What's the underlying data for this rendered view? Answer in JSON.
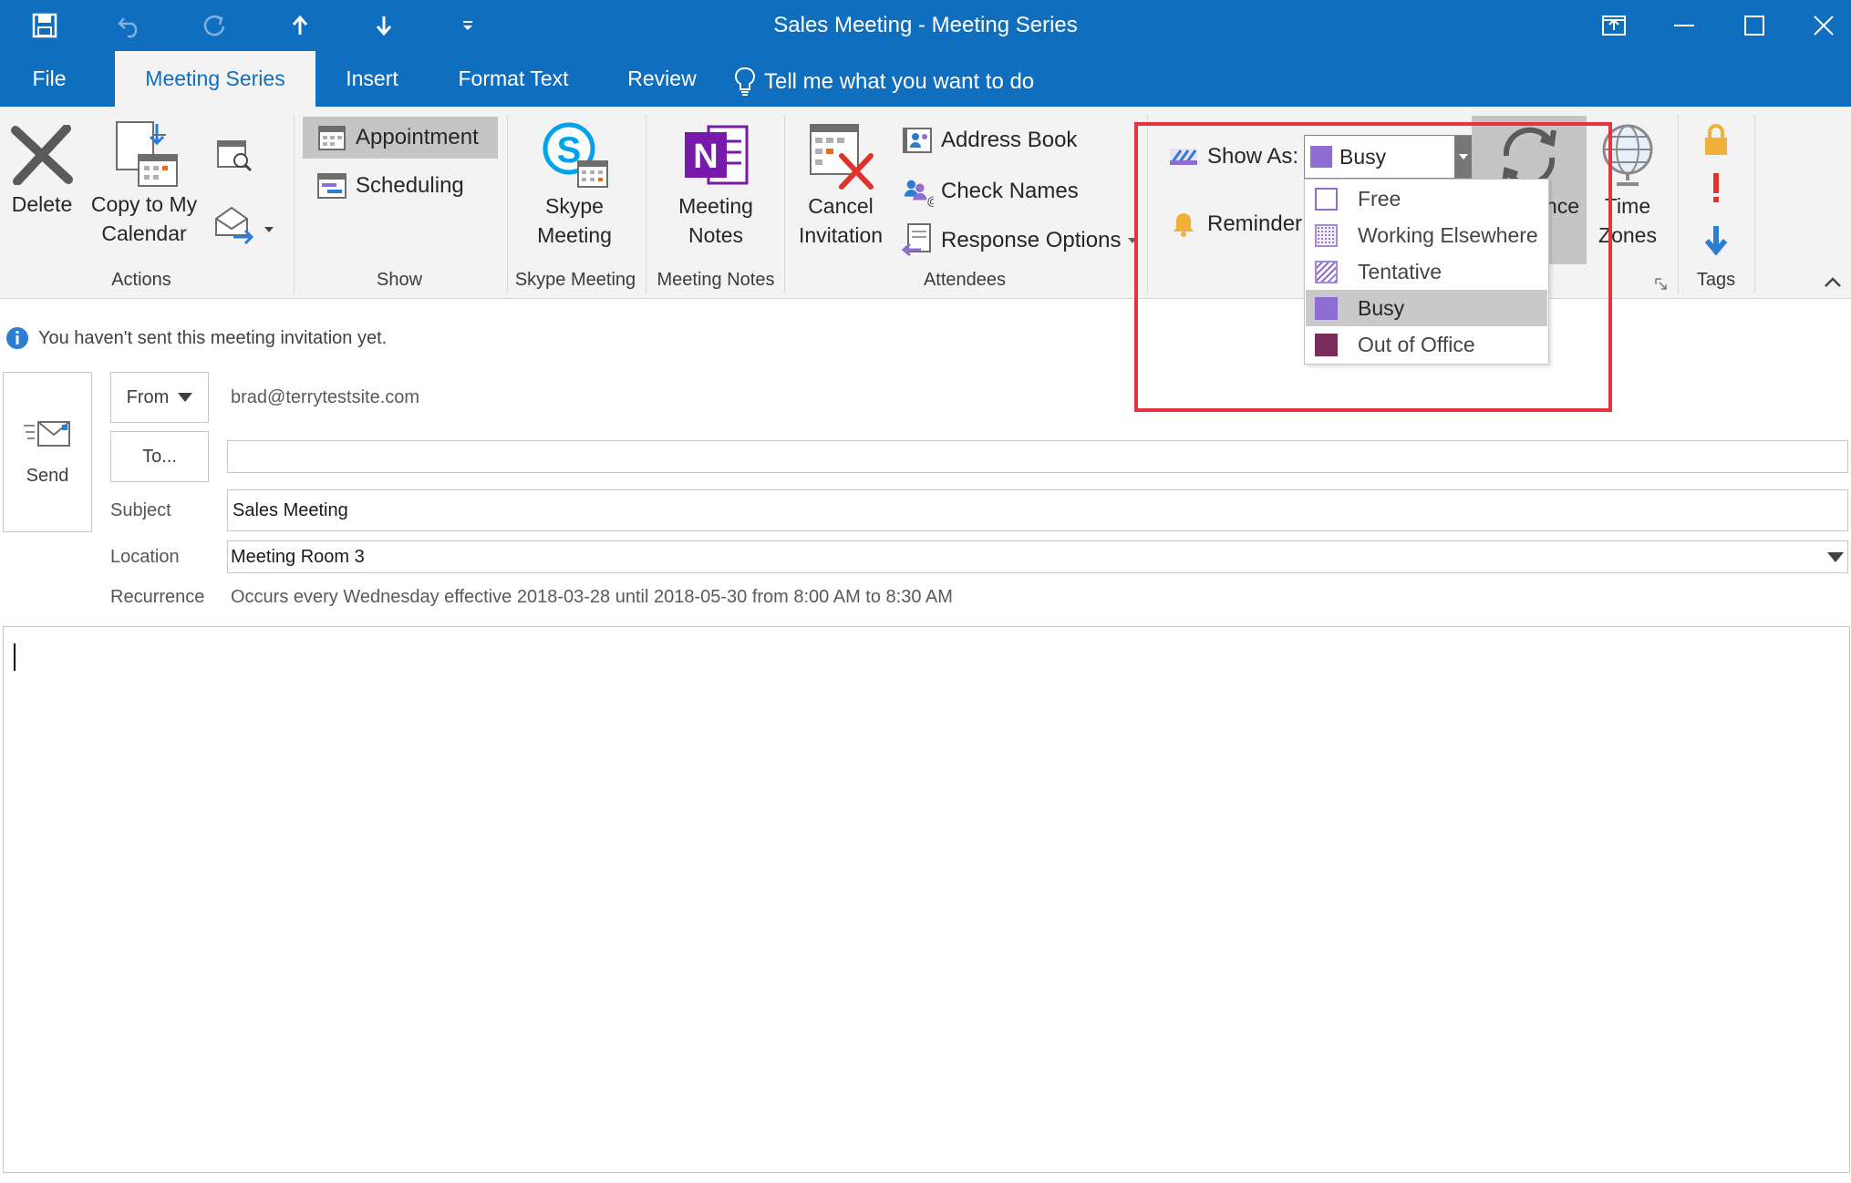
{
  "window": {
    "title": "Sales Meeting  -  Meeting Series"
  },
  "tabs": [
    {
      "label": "File"
    },
    {
      "label": "Meeting Series"
    },
    {
      "label": "Insert"
    },
    {
      "label": "Format Text"
    },
    {
      "label": "Review"
    }
  ],
  "tell_me": "Tell me what you want to do",
  "ribbon": {
    "actions": {
      "delete": "Delete",
      "copy_line1": "Copy to My",
      "copy_line2": "Calendar",
      "group": "Actions"
    },
    "show": {
      "appointment": "Appointment",
      "scheduling": "Scheduling",
      "group": "Show"
    },
    "skype": {
      "line1": "Skype",
      "line2": "Meeting",
      "group": "Skype Meeting"
    },
    "notes": {
      "line1": "Meeting",
      "line2": "Notes",
      "group": "Meeting Notes"
    },
    "attendees": {
      "cancel_line1": "Cancel",
      "cancel_line2": "Invitation",
      "address_book": "Address Book",
      "check_names": "Check Names",
      "response_options": "Response Options",
      "group": "Attendees"
    },
    "options": {
      "show_as_label": "Show As:",
      "show_as_value": "Busy",
      "reminder_label": "Reminder:",
      "recurrence_fragment": "nce",
      "time_zones_line1": "Time",
      "time_zones_line2": "Zones"
    },
    "tags": {
      "group": "Tags"
    }
  },
  "show_as_menu": {
    "items": [
      {
        "label": "Free",
        "color": "#ffffff"
      },
      {
        "label": "Working Elsewhere",
        "color": "#e8e0f5"
      },
      {
        "label": "Tentative",
        "color": "#d9cdf0"
      },
      {
        "label": "Busy",
        "color": "#8e6fd1"
      },
      {
        "label": "Out of Office",
        "color": "#7a2c5a"
      }
    ],
    "selected": "Busy"
  },
  "info_bar": "You haven't sent this meeting invitation yet.",
  "form": {
    "send": "Send",
    "from_button": "From",
    "from_value": "brad@terrytestsite.com",
    "to_button": "To...",
    "to_value": "",
    "subject_label": "Subject",
    "subject_value": "Sales Meeting",
    "location_label": "Location",
    "location_value": "Meeting Room 3",
    "recurrence_label": "Recurrence",
    "recurrence_value": "Occurs every Wednesday effective 2018-03-28 until 2018-05-30 from 8:00 AM to 8:30 AM"
  },
  "colors": {
    "accent": "#106ebe",
    "ribbon_bg": "#f3f3f3",
    "highlight": "#e8323c"
  }
}
